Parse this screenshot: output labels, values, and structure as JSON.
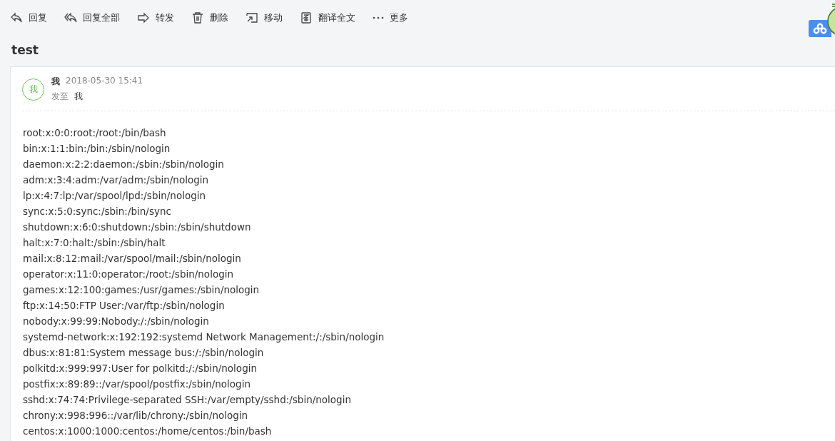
{
  "toolbar": [
    {
      "kind": "reply",
      "label": "回复"
    },
    {
      "kind": "reply-all",
      "label": "回复全部"
    },
    {
      "kind": "forward",
      "label": "转发"
    },
    {
      "kind": "delete",
      "label": "删除"
    },
    {
      "kind": "move",
      "label": "移动"
    },
    {
      "kind": "translate",
      "label": "翻译全文"
    },
    {
      "kind": "more",
      "label": "更多"
    }
  ],
  "subject": "test",
  "message": {
    "avatar": "我",
    "sender": "我",
    "date": "2018-05-30 15:41",
    "to_label": "发至",
    "to": "我",
    "body": [
      "root:x:0:0:root:/root:/bin/bash",
      "bin:x:1:1:bin:/bin:/sbin/nologin",
      "daemon:x:2:2:daemon:/sbin:/sbin/nologin",
      "adm:x:3:4:adm:/var/adm:/sbin/nologin",
      "lp:x:4:7:lp:/var/spool/lpd:/sbin/nologin",
      "sync:x:5:0:sync:/sbin:/bin/sync",
      "shutdown:x:6:0:shutdown:/sbin:/sbin/shutdown",
      "halt:x:7:0:halt:/sbin:/sbin/halt",
      "mail:x:8:12:mail:/var/spool/mail:/sbin/nologin",
      "operator:x:11:0:operator:/root:/sbin/nologin",
      "games:x:12:100:games:/usr/games:/sbin/nologin",
      "ftp:x:14:50:FTP User:/var/ftp:/sbin/nologin",
      "nobody:x:99:99:Nobody:/:/sbin/nologin",
      "systemd-network:x:192:192:systemd Network Management:/:/sbin/nologin",
      "dbus:x:81:81:System message bus:/:/sbin/nologin",
      "polkitd:x:999:997:User for polkitd:/:/sbin/nologin",
      "postfix:x:89:89::/var/spool/postfix:/sbin/nologin",
      "sshd:x:74:74:Privilege-separated SSH:/var/empty/sshd:/sbin/nologin",
      "chrony:x:998:996::/var/lib/chrony:/sbin/nologin",
      "centos:x:1000:1000:centos:/home/centos:/bin/bash"
    ]
  }
}
